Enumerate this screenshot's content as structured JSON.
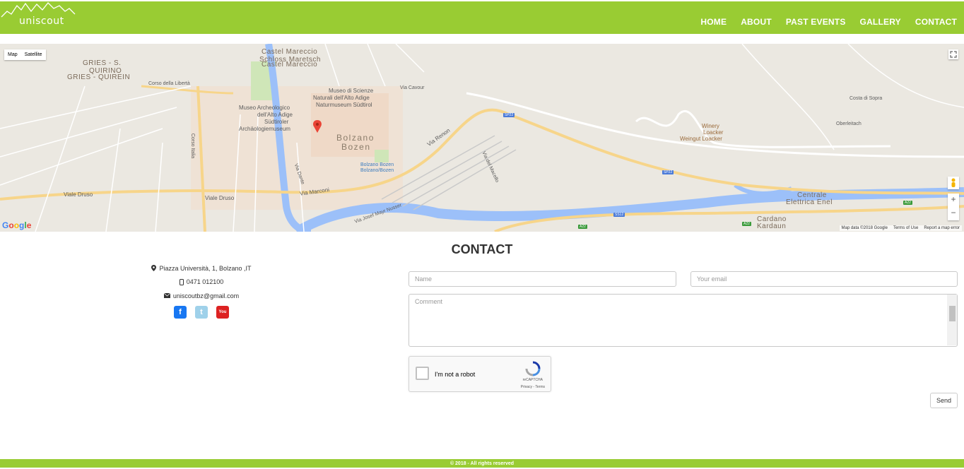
{
  "brand": {
    "logo_text": "uniscout",
    "accent_color": "#99cc33"
  },
  "nav": {
    "items": [
      {
        "label": "HOME"
      },
      {
        "label": "ABOUT"
      },
      {
        "label": "PAST EVENTS"
      },
      {
        "label": "GALLERY"
      },
      {
        "label": "CONTACT"
      }
    ]
  },
  "map": {
    "type_buttons": {
      "map": "Map",
      "satellite": "Satellite"
    },
    "zoom_in": "+",
    "zoom_out": "−",
    "google_logo": "Google",
    "attribution": {
      "data": "Map data ©2018 Google",
      "terms": "Terms of Use",
      "report": "Report a map error"
    },
    "labels": {
      "castel_1": "Castel Mareccio",
      "castel_2": "Schloss Maretsch",
      "castel_3": "Castel Mareccio",
      "gries_1": "GRIES - S.",
      "gries_2": "QUIRINO",
      "gries_3": "GRIES - QUIREIN",
      "museo_sc_1": "Museo di Scienze",
      "museo_sc_2": "Naturali dell'Alto Adige",
      "museo_sc_3": "Naturmuseum Südtirol",
      "museo_ar_1": "Museo Archeologico",
      "museo_ar_2": "dell'Alto Adige",
      "museo_ar_3": "Südtiroler",
      "museo_ar_4": "Archäologiemuseum",
      "bolzano": "Bolzano",
      "bozen": "Bozen",
      "station_1": "Bolzano Bozen",
      "station_2": "Bolzano/Bozen",
      "via_renon": "Via Renon",
      "via_marconi": "Via Marconi",
      "viale_druso_1": "Viale Druso",
      "viale_druso_2": "Viale Druso",
      "corso_liberta": "Corso della Libertà",
      "corso_italia": "Corso Italia",
      "via_cavour": "Via Cavour",
      "winery_1": "Winery",
      "winery_2": "Loacker",
      "winery_3": "Weingut Loacker",
      "costa_sopra": "Costa di Sopra",
      "oberleitach": "Oberleitach",
      "centrale_1": "Centrale",
      "centrale_2": "Elettrica Enel",
      "cardano_1": "Cardano",
      "cardano_2": "Kardaun",
      "via_josef": "Via Josef Mayr Nusser",
      "via_macello": "Via del Macello",
      "via_dante": "Via Dante",
      "sp22_1": "SP22",
      "sp22_2": "SP22",
      "ss12": "SS12",
      "a22_1": "A22",
      "a22_2": "A22",
      "a22_3": "A22"
    }
  },
  "contact": {
    "title": "CONTACT",
    "address": "Piazza Università, 1, Bolzano ,IT",
    "phone": "0471 012100",
    "email": "uniscoutbz@gmail.com",
    "social": {
      "facebook": "f",
      "twitter": "t",
      "youtube": "You Tube"
    },
    "form": {
      "name_placeholder": "Name",
      "email_placeholder": "Your email",
      "comment_placeholder": "Comment",
      "captcha_label": "I'm not a robot",
      "captcha_brand": "reCAPTCHA",
      "captcha_links": "Privacy - Terms",
      "send_label": "Send"
    }
  },
  "footer": {
    "text": "© 2018 - All rights reserved"
  }
}
